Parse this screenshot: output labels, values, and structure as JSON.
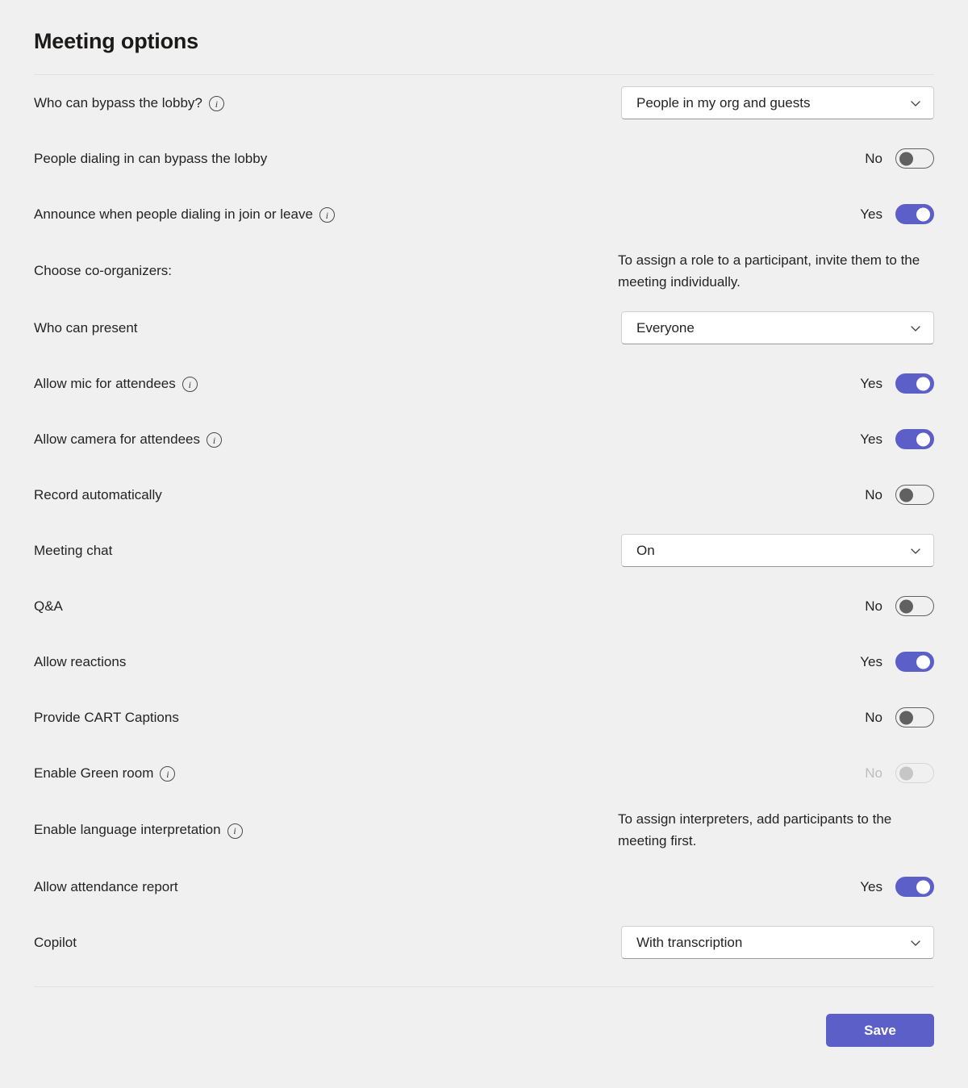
{
  "page": {
    "title": "Meeting options"
  },
  "options": [
    {
      "label": "Who can bypass the lobby?",
      "has_info": true,
      "control": "dropdown",
      "value": "People in my org and guests"
    },
    {
      "label": "People dialing in can bypass the lobby",
      "has_info": false,
      "control": "toggle",
      "state": "off",
      "state_label": "No"
    },
    {
      "label": "Announce when people dialing in join or leave",
      "has_info": true,
      "control": "toggle",
      "state": "on",
      "state_label": "Yes"
    },
    {
      "label": "Choose co-organizers:",
      "has_info": false,
      "control": "text",
      "value": "To assign a role to a participant, invite them to the meeting individually."
    },
    {
      "label": "Who can present",
      "has_info": false,
      "control": "dropdown",
      "value": "Everyone"
    },
    {
      "label": "Allow mic for attendees",
      "has_info": true,
      "control": "toggle",
      "state": "on",
      "state_label": "Yes"
    },
    {
      "label": "Allow camera for attendees",
      "has_info": true,
      "control": "toggle",
      "state": "on",
      "state_label": "Yes"
    },
    {
      "label": "Record automatically",
      "has_info": false,
      "control": "toggle",
      "state": "off",
      "state_label": "No"
    },
    {
      "label": "Meeting chat",
      "has_info": false,
      "control": "dropdown",
      "value": "On"
    },
    {
      "label": "Q&A",
      "has_info": false,
      "control": "toggle",
      "state": "off",
      "state_label": "No"
    },
    {
      "label": "Allow reactions",
      "has_info": false,
      "control": "toggle",
      "state": "on",
      "state_label": "Yes"
    },
    {
      "label": "Provide CART Captions",
      "has_info": false,
      "control": "toggle",
      "state": "off",
      "state_label": "No"
    },
    {
      "label": "Enable Green room",
      "has_info": true,
      "control": "toggle",
      "state": "off-disabled",
      "state_label": "No"
    },
    {
      "label": "Enable language interpretation",
      "has_info": true,
      "control": "text",
      "value": "To assign interpreters, add participants to the meeting first."
    },
    {
      "label": "Allow attendance report",
      "has_info": false,
      "control": "toggle",
      "state": "on",
      "state_label": "Yes"
    },
    {
      "label": "Copilot",
      "has_info": false,
      "control": "dropdown",
      "value": "With transcription"
    }
  ],
  "footer": {
    "save_label": "Save"
  },
  "icons": {
    "info": "i",
    "chevron_down": "chevron-down-icon"
  },
  "colors": {
    "accent": "#5b5fc7",
    "background": "#f0f0f0",
    "text": "#242424",
    "toggle_off": "#616161",
    "toggle_disabled": "#c6c6c6",
    "divider": "#e1e1e1"
  }
}
